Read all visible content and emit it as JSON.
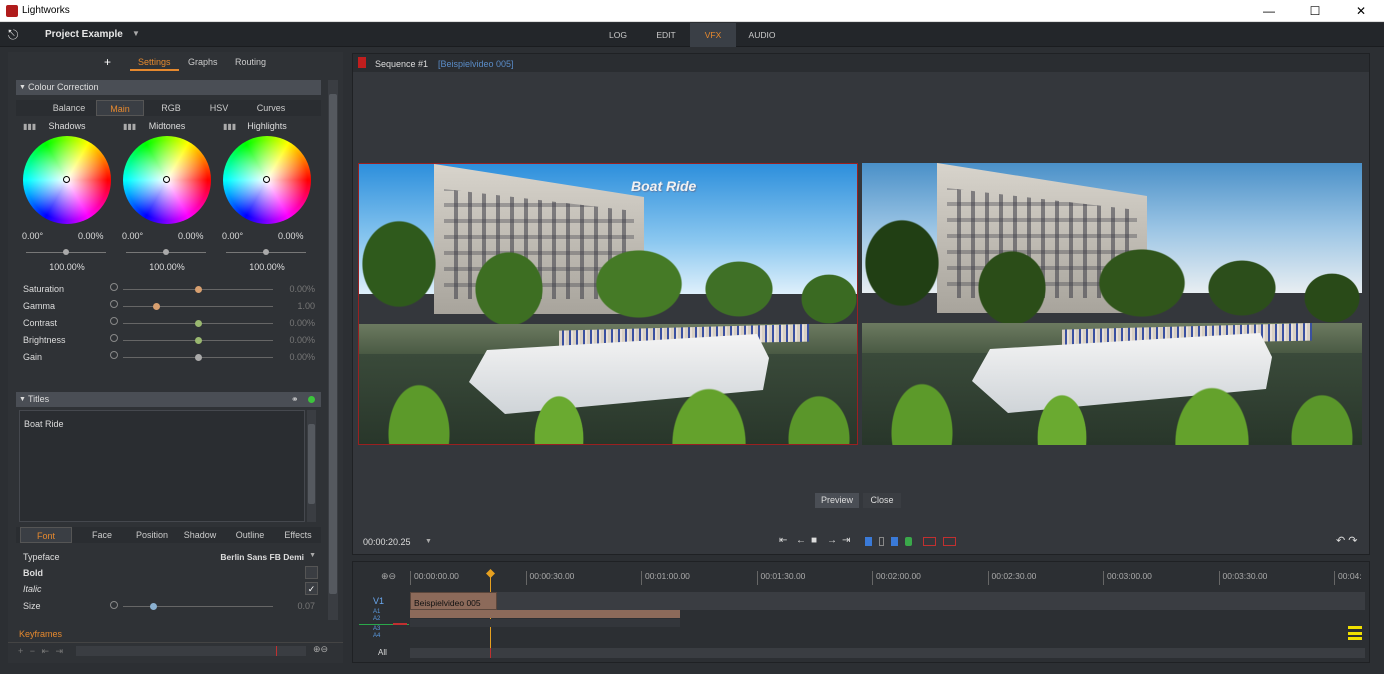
{
  "window": {
    "title": "Lightworks",
    "minimize_icon": "—",
    "maximize_icon": "☐",
    "close_icon": "✕"
  },
  "header": {
    "project_title": "Project Example",
    "project_dropdown_icon": "▼",
    "exit_icon": "⎋"
  },
  "nav_tabs": [
    {
      "label": "LOG"
    },
    {
      "label": "EDIT"
    },
    {
      "label": "VFX",
      "active": true
    },
    {
      "label": "AUDIO"
    }
  ],
  "left_tabs": {
    "add": "+",
    "settings": "Settings",
    "graphs": "Graphs",
    "routing": "Routing"
  },
  "colour_correction": {
    "title": "Colour Correction",
    "subtabs": [
      "Balance",
      "Main",
      "RGB",
      "HSV",
      "Curves"
    ],
    "active_subtab": "Main",
    "wheels": [
      {
        "label": "Shadows",
        "angle": "0.00°",
        "amount": "0.00%",
        "level": "100.00%"
      },
      {
        "label": "Midtones",
        "angle": "0.00°",
        "amount": "0.00%",
        "level": "100.00%"
      },
      {
        "label": "Highlights",
        "angle": "0.00°",
        "amount": "0.00%",
        "level": "100.00%"
      }
    ],
    "sliders": [
      {
        "label": "Saturation",
        "value": "0.00%",
        "position": 0.5,
        "knob_color": "#d8a070"
      },
      {
        "label": "Gamma",
        "value": "1.00",
        "position": 0.22,
        "knob_color": "#d8a070"
      },
      {
        "label": "Contrast",
        "value": "0.00%",
        "position": 0.5,
        "knob_color": "#9ab870"
      },
      {
        "label": "Brightness",
        "value": "0.00%",
        "position": 0.5,
        "knob_color": "#9ab870"
      },
      {
        "label": "Gain",
        "value": "0.00%",
        "position": 0.5,
        "knob_color": "#aaaaaa"
      }
    ]
  },
  "titles": {
    "title": "Titles",
    "text_content": "Boat Ride",
    "subtabs": [
      "Font",
      "Face",
      "Position",
      "Shadow",
      "Outline",
      "Effects"
    ],
    "active_subtab": "Font",
    "typeface_label": "Typeface",
    "typeface_value": "Berlin Sans FB Demi",
    "bold_label": "Bold",
    "italic_label": "Italic",
    "italic_check": "✓",
    "size_label": "Size",
    "size_value": "0.07",
    "size_position": 0.2
  },
  "keyframes": {
    "label": "Keyframes",
    "controls": "+ − ⇤ ⇥"
  },
  "viewer": {
    "sequence_title": "Sequence #1",
    "clip_name": "[Beispielvideo 005]",
    "title_overlay": "Boat Ride",
    "preview_label": "Preview",
    "close_label": "Close",
    "timecode": "00:00:20.25",
    "timecode_dropdown": "▼",
    "transport": [
      "⇤",
      "←",
      "■",
      "→",
      "⇥"
    ],
    "undo_icons": "↶ ↷"
  },
  "timeline": {
    "ticks": [
      "00:00:00.00",
      "00:00:30.00",
      "00:01:00.00",
      "00:01:30.00",
      "00:02:00.00",
      "00:02:30.00",
      "00:03:00.00",
      "00:03:30.00",
      "00:04:"
    ],
    "video_track": "V1",
    "audio_tracks": [
      "A1",
      "A2",
      "A3",
      "A4"
    ],
    "all_label": "All",
    "clip_label": "Beispielvideo 005"
  }
}
